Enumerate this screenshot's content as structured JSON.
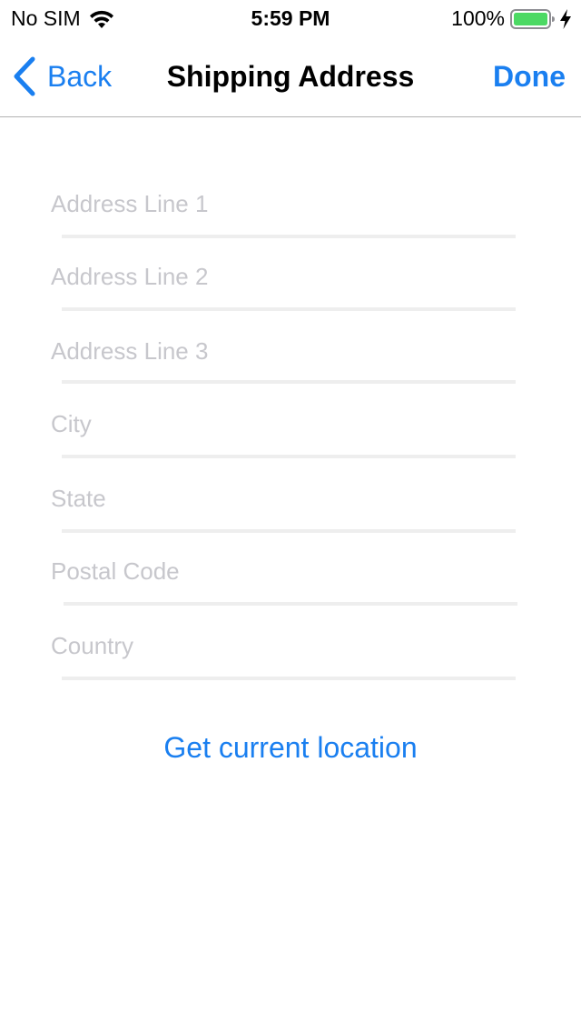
{
  "status_bar": {
    "carrier": "No SIM",
    "time": "5:59 PM",
    "battery": "100%",
    "battery_color": "#4cd964"
  },
  "nav": {
    "back_label": "Back",
    "title": "Shipping Address",
    "done_label": "Done",
    "accent_color": "#1a7ff0"
  },
  "form": {
    "fields": [
      {
        "placeholder": "Address Line 1",
        "value": ""
      },
      {
        "placeholder": "Address Line 2",
        "value": ""
      },
      {
        "placeholder": "Address Line 3",
        "value": ""
      },
      {
        "placeholder": "City",
        "value": ""
      },
      {
        "placeholder": "State",
        "value": ""
      },
      {
        "placeholder": "Postal Code",
        "value": ""
      },
      {
        "placeholder": "Country",
        "value": ""
      }
    ]
  },
  "actions": {
    "location_label": "Get current location"
  },
  "icons": [
    "wifi-icon",
    "battery-icon",
    "charging-bolt-icon",
    "chevron-left-icon"
  ]
}
